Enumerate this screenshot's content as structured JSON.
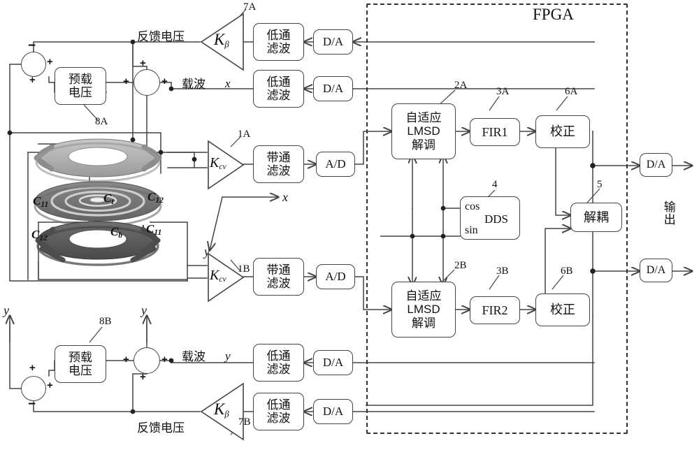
{
  "diagram": {
    "title_fpga": "FPGA",
    "output_label": "输\n出"
  },
  "blocks": {
    "preload_x": {
      "line1": "预载",
      "line2": "电压",
      "ref": "8A"
    },
    "preload_y": {
      "line1": "预载",
      "line2": "电压",
      "ref": "8B"
    },
    "lowpass_fb_x": {
      "line1": "低通",
      "line2": "滤波"
    },
    "lowpass_carrier_x": {
      "line1": "低通",
      "line2": "滤波"
    },
    "lowpass_carrier_y": {
      "line1": "低通",
      "line2": "滤波"
    },
    "lowpass_fb_y": {
      "line1": "低通",
      "line2": "滤波"
    },
    "bandpass_x": {
      "line1": "带通",
      "line2": "滤波"
    },
    "bandpass_y": {
      "line1": "带通",
      "line2": "滤波"
    },
    "da_fb_x": {
      "label": "D/A"
    },
    "da_carrier_x": {
      "label": "D/A"
    },
    "da_carrier_y": {
      "label": "D/A"
    },
    "da_fb_y": {
      "label": "D/A"
    },
    "ad_x": {
      "label": "A/D"
    },
    "ad_y": {
      "label": "A/D"
    },
    "da_out_x": {
      "label": "D/A"
    },
    "da_out_y": {
      "label": "D/A"
    },
    "lmsd_x": {
      "line1": "自适应",
      "line2": "LMSD",
      "line3": "解调",
      "ref": "2A"
    },
    "lmsd_y": {
      "line1": "自适应",
      "line2": "LMSD",
      "line3": "解调",
      "ref": "2B"
    },
    "fir1": {
      "label": "FIR1",
      "ref": "3A"
    },
    "fir2": {
      "label": "FIR2",
      "ref": "3B"
    },
    "correct_x": {
      "label": "校正",
      "ref": "6A"
    },
    "correct_y": {
      "label": "校正",
      "ref": "6B"
    },
    "dds": {
      "cos": "cos",
      "name": "DDS",
      "sin": "sin",
      "ref": "4"
    },
    "decouple": {
      "label": "解耦",
      "ref": "5"
    }
  },
  "amplifiers": {
    "kbeta_x": {
      "gain": "K",
      "sub": "β",
      "ref": "7A"
    },
    "kbeta_y": {
      "gain": "K",
      "sub": "β",
      "ref": "7B"
    },
    "kcv_x": {
      "gain": "K",
      "sub": "cv",
      "ref": "1A"
    },
    "kcv_y": {
      "gain": "K",
      "sub": "cv",
      "ref": "1B"
    }
  },
  "signal_labels": {
    "feedback_voltage_x": "反馈电压",
    "carrier_x": "载波",
    "carrier_axis_x": "x",
    "feedback_voltage_y": "反馈电压",
    "carrier_y": "载波",
    "carrier_axis_y": "y",
    "axis_x": "x",
    "axis_y_amp": "y",
    "axis_y_left": "y",
    "axis_y_mid": "y"
  },
  "gyroscope": {
    "capacitors": [
      {
        "name": "C",
        "sub": "11"
      },
      {
        "name": "C",
        "sub": "t"
      },
      {
        "name": "C",
        "sub": "12"
      },
      {
        "name": "C",
        "sub": "12"
      },
      {
        "name": "C",
        "sub": "b"
      },
      {
        "name": "C",
        "sub": "11"
      }
    ]
  },
  "sum_signs": {
    "sum_x_left": [
      "−",
      "+",
      "+"
    ],
    "sum_x_mid": [
      "+",
      "+",
      "+"
    ],
    "sum_y_left": [
      "+",
      "+",
      "−"
    ],
    "sum_y_mid": [
      "+",
      "+",
      "+"
    ]
  },
  "colors": {
    "line": "#444444",
    "text": "#111111",
    "dash": "#333333"
  }
}
